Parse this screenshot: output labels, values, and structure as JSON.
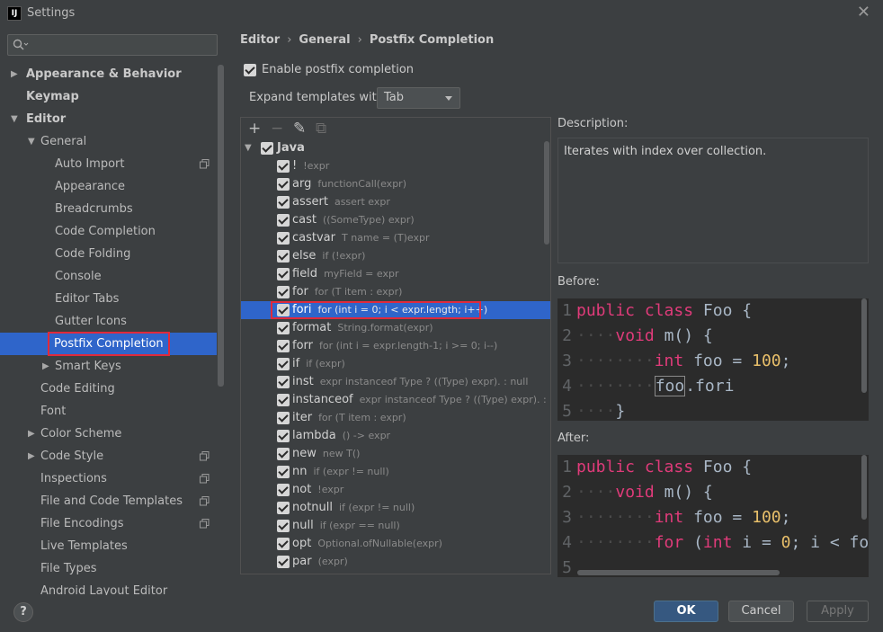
{
  "window": {
    "app_icon_text": "IJ",
    "title": "Settings",
    "close_glyph": "✕"
  },
  "sidebar": {
    "search": {
      "placeholder": "",
      "value": ""
    },
    "items": [
      {
        "label": "Appearance & Behavior",
        "indent": 0,
        "arrow": "▶",
        "bold": true
      },
      {
        "label": "Keymap",
        "indent": 0,
        "arrow": "",
        "bold": true
      },
      {
        "label": "Editor",
        "indent": 0,
        "arrow": "▼",
        "bold": true
      },
      {
        "label": "General",
        "indent": 1,
        "arrow": "▼"
      },
      {
        "label": "Auto Import",
        "indent": 2,
        "copy_icon": true
      },
      {
        "label": "Appearance",
        "indent": 2
      },
      {
        "label": "Breadcrumbs",
        "indent": 2
      },
      {
        "label": "Code Completion",
        "indent": 2
      },
      {
        "label": "Code Folding",
        "indent": 2
      },
      {
        "label": "Console",
        "indent": 2
      },
      {
        "label": "Editor Tabs",
        "indent": 2
      },
      {
        "label": "Gutter Icons",
        "indent": 2
      },
      {
        "label": "Postfix Completion",
        "indent": 2,
        "selected": true
      },
      {
        "label": "Smart Keys",
        "indent": 2,
        "arrow": "▶"
      },
      {
        "label": "Code Editing",
        "indent": 1
      },
      {
        "label": "Font",
        "indent": 1
      },
      {
        "label": "Color Scheme",
        "indent": 1,
        "arrow": "▶"
      },
      {
        "label": "Code Style",
        "indent": 1,
        "arrow": "▶",
        "copy_icon": true
      },
      {
        "label": "Inspections",
        "indent": 1,
        "copy_icon": true
      },
      {
        "label": "File and Code Templates",
        "indent": 1,
        "copy_icon": true
      },
      {
        "label": "File Encodings",
        "indent": 1,
        "copy_icon": true
      },
      {
        "label": "Live Templates",
        "indent": 1
      },
      {
        "label": "File Types",
        "indent": 1
      },
      {
        "label": "Android Layout Editor",
        "indent": 1
      }
    ]
  },
  "breadcrumb": [
    "Editor",
    "General",
    "Postfix Completion"
  ],
  "breadcrumb_sep": "›",
  "enable_postfix": {
    "label": "Enable postfix completion",
    "checked": true
  },
  "expand_templates": {
    "label": "Expand templates with",
    "value": "Tab"
  },
  "toolbar": {
    "add": "+",
    "remove": "−",
    "edit": "✎",
    "copy": "⧉"
  },
  "templates": {
    "group": "Java",
    "group_arrow": "▼",
    "rows": [
      {
        "key": "!",
        "expr": "!expr"
      },
      {
        "key": "arg",
        "expr": "functionCall(expr)"
      },
      {
        "key": "assert",
        "expr": "assert expr"
      },
      {
        "key": "cast",
        "expr": "((SomeType) expr)"
      },
      {
        "key": "castvar",
        "expr": "T name = (T)expr"
      },
      {
        "key": "else",
        "expr": "if (!expr)"
      },
      {
        "key": "field",
        "expr": "myField = expr"
      },
      {
        "key": "for",
        "expr": "for (T item : expr)"
      },
      {
        "key": "fori",
        "expr": "for (int i = 0; i < expr.length; i++)",
        "selected": true
      },
      {
        "key": "format",
        "expr": "String.format(expr)"
      },
      {
        "key": "forr",
        "expr": "for (int i = expr.length-1; i >= 0; i--)"
      },
      {
        "key": "if",
        "expr": "if (expr)"
      },
      {
        "key": "inst",
        "expr": "expr instanceof Type ? ((Type) expr). : null"
      },
      {
        "key": "instanceof",
        "expr": "expr instanceof Type ? ((Type) expr). : null"
      },
      {
        "key": "iter",
        "expr": "for (T item : expr)"
      },
      {
        "key": "lambda",
        "expr": "() -> expr"
      },
      {
        "key": "new",
        "expr": "new T()"
      },
      {
        "key": "nn",
        "expr": "if (expr != null)"
      },
      {
        "key": "not",
        "expr": "!expr"
      },
      {
        "key": "notnull",
        "expr": "if (expr != null)"
      },
      {
        "key": "null",
        "expr": "if (expr == null)"
      },
      {
        "key": "opt",
        "expr": "Optional.ofNullable(expr)"
      },
      {
        "key": "par",
        "expr": "(expr)"
      }
    ]
  },
  "description": {
    "label": "Description:",
    "text": "Iterates with index over collection."
  },
  "before": {
    "label": "Before:",
    "line_numbers": [
      "1",
      "2",
      "3",
      "4",
      "5"
    ]
  },
  "after": {
    "label": "After:",
    "line_numbers": [
      "1",
      "2",
      "3",
      "4",
      "5"
    ]
  },
  "code_tokens": {
    "public": "public",
    "class": "class",
    "Foo": "Foo",
    "open": "{",
    "void": "void",
    "m": "m()",
    "int": "int",
    "foo": "foo",
    "eq": "=",
    "hundred": "100",
    "semi": ";",
    "fori": ".fori",
    "close": "}",
    "for": "for",
    "paren": "(",
    "i": "i",
    "zero": "0",
    "lt": "<",
    "fo": "fo"
  },
  "buttons": {
    "help": "?",
    "ok": "OK",
    "cancel": "Cancel",
    "apply": "Apply"
  },
  "colors": {
    "selection": "#2f65ca",
    "highlight_outline": "#e02a3b",
    "keyword": "#e03b7a",
    "number": "#e8bf6a"
  }
}
